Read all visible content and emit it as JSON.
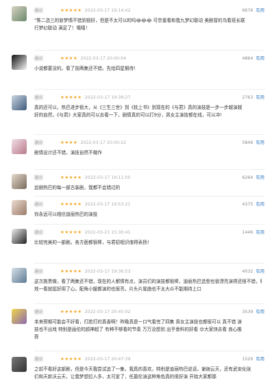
{
  "reviews": [
    {
      "user": "进过",
      "stars": "★★★★★",
      "date": "2022-03-17 19:14:42",
      "count": "6676",
      "useful": "有用",
      "lines": [
        "“陈二选三的新梦情不错到很好，但是不太可以的吗😂😂😂 可奈量看和我九梦幻联动 美剧冒的乌看班长联",
        "行梦幻联动 满足了！嘻嘻！"
      ]
    },
    {
      "user": "进过",
      "stars": "★★★★",
      "date": "2022-03-17 20:00:04",
      "count": "4864",
      "useful": "有用",
      "lines": [
        "小说都要没的。看了前两集还不错。先给四星期待！"
      ]
    },
    {
      "user": "进过",
      "stars": "★★★★★",
      "date": "2022-03-17 19:39:27",
      "count": "2763",
      "useful": "有用",
      "lines": [
        "真的还可以，热巴进步很大，从《三生三世》到《枕上书》到现在的《与君》真的演技是一步一步越演越",
        "好的自然，《与君》大家真的可以去看一下，剧情真的可以打9分，男女主演技都在线，可以冲!"
      ]
    },
    {
      "user": "进过",
      "stars": "★★★★",
      "date": "2022-03-17 20:00:22",
      "count": "5846",
      "useful": "有用",
      "lines": [
        "剧情设计还不错，演技自然不做作"
      ]
    },
    {
      "user": "进过",
      "stars": "★★★★★",
      "date": "2022-03-17 19:11:00",
      "count": "6264",
      "useful": "有用",
      "lines": [
        "追剧热巴的每一部古装剧，我都不会错过的"
      ]
    },
    {
      "user": "进过",
      "stars": "★★★★★",
      "date": "2022-03-17 19:53:21",
      "count": "4375",
      "useful": "有用",
      "lines": [
        "你永远可以相信迪丽热巴的演技"
      ]
    },
    {
      "user": "进过",
      "stars": "★★★★★",
      "date": "2022-03-21 15:30:41",
      "count": "1446",
      "useful": "有用",
      "lines": [
        "比较完美的一部剧。各方面都很棒，与君初相识值得表扬！"
      ]
    },
    {
      "user": "进过",
      "stars": "★★★★★",
      "date": "2022-03-17 19:36:53",
      "count": "4032",
      "useful": "有用",
      "lines": [
        "这次挑票做，看了两集还不错，现在的人都情有点，演员们的演技都很棒，迪丽热巴造型也很漂亮演得还很不错，特",
        "效一看就挺好用了心。配角小媛都演的也很亮，片头片尾曲也不太大众不能期待上口"
      ]
    },
    {
      "user": "进过",
      "stars": "★★★★★",
      "date": "2022-03-17 20:45:02",
      "count": "3539",
      "useful": "有用",
      "lines": [
        "本来预期可能会不好看，打脸打的真香啊！昨晚真是一口气看完了四集 男女主演技也都很可以 真不错 演",
        "技也不出戏 特别是画伦的颜神超了 有种不够看的节奏 万万没想到 出乎意料的好看 😍大家快去看 良心推",
        "荐"
      ]
    },
    {
      "user": "进过",
      "stars": "★★★★★",
      "date": "2022-03-17 20:47:39",
      "count": "1529",
      "useful": "有用",
      "lines": [
        "之前不看好这部剧，但是今天我尝试追了一集，我真的喜欢，特别是迪丽热巴说话，谢谢云天，还有武安化张",
        "们和天新沃云天，让我梦想拉入多，太可爱了，任嘉伦演这种角色真的很好演 开始大家都那"
      ]
    }
  ]
}
